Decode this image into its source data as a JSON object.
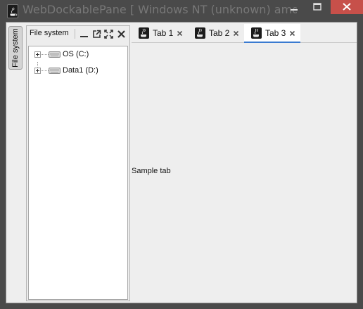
{
  "window": {
    "title": "WebDockablePane [ Windows NT (unknown) amd64 ] [ ...",
    "app_icon": "java-coffee-icon",
    "controls": [
      "minimize-icon",
      "maximize-icon",
      "close-icon"
    ],
    "close_button_color": "#c7504a"
  },
  "side_tab": {
    "label": "File system"
  },
  "file_system_pane": {
    "title": "File system",
    "header_buttons": [
      "minimize-icon",
      "float-icon",
      "maximize-icon",
      "close-icon"
    ],
    "tree": [
      {
        "label": "OS (C:)",
        "icon": "hard-drive-icon",
        "expandable": true
      },
      {
        "label": "Data1 (D:)",
        "icon": "hard-drive-icon",
        "expandable": true
      }
    ]
  },
  "tabs": [
    {
      "label": "Tab 1",
      "icon": "java-coffee-icon",
      "selected": false
    },
    {
      "label": "Tab 2",
      "icon": "java-coffee-icon",
      "selected": false
    },
    {
      "label": "Tab 3",
      "icon": "java-coffee-icon",
      "selected": true
    }
  ],
  "content": {
    "text": "Sample tab"
  },
  "colors": {
    "selected_tab_underline": "#3a7ad0",
    "window_frame": "#4a4a4a"
  }
}
